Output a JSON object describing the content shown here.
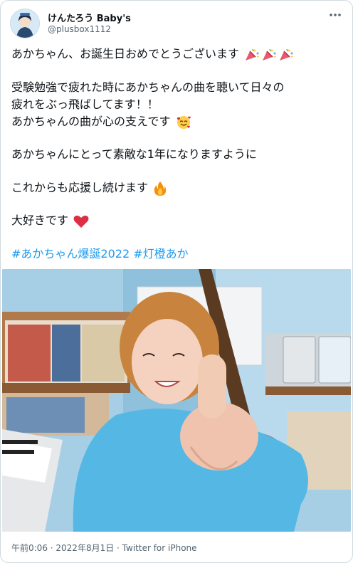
{
  "author": {
    "display_name": "けんたろう Baby's",
    "handle": "@plusbox1112"
  },
  "tweet": {
    "line1": "あかちゃん、お誕生日おめでとうございます",
    "line2": "受験勉強で疲れた時にあかちゃんの曲を聴いて日々の",
    "line3": "疲れをぶっ飛ばしてます！！",
    "line4": "あかちゃんの曲が心の支えです",
    "line5": "あかちゃんにとって素敵な1年になりますように",
    "line6": "これからも応援し続けます",
    "line7": "大好きです",
    "hashtag1": "#あかちゃん爆誕2022",
    "hashtag2": "#灯橙あか"
  },
  "footer": {
    "time": "午前0:06",
    "sep1": " · ",
    "date": "2022年8月1日",
    "sep2": " · ",
    "source": "Twitter for iPhone"
  },
  "icons": {
    "more": "more-icon",
    "party": "party-popper-icon",
    "smile": "smiling-face-with-hearts-icon",
    "fire": "fire-icon",
    "heart": "red-heart-icon"
  },
  "colors": {
    "link": "#1d9bf0",
    "text": "#0f1419",
    "muted": "#536471",
    "border": "#cfd9de"
  }
}
